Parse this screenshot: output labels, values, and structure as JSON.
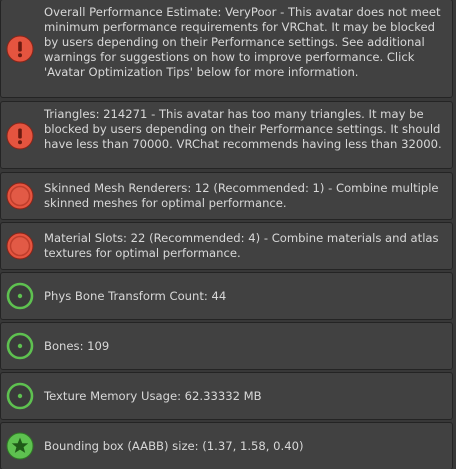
{
  "colors": {
    "error_red": "#e5543f",
    "ok_green": "#5ec150",
    "row_bg": "#414141",
    "row_border": "#242424",
    "text": "#d8d8d8"
  },
  "messages": [
    {
      "icon": "error-exclamation-icon",
      "severity": "error",
      "text": "Overall Performance Estimate: VeryPoor - This avatar does not meet minimum performance requirements for VRChat. It may be blocked by users depending on their Performance settings. See additional warnings for suggestions on how to improve performance. Click 'Avatar Optimization Tips' below for more information."
    },
    {
      "icon": "error-exclamation-icon",
      "severity": "error",
      "text": "Triangles: 214271 - This avatar has too many triangles. It may be blocked by users depending on their Performance settings. It should have less than 70000. VRChat recommends having less than 32000."
    },
    {
      "icon": "error-dot-icon",
      "severity": "warning",
      "text": "Skinned Mesh Renderers: 12 (Recommended: 1) - Combine multiple skinned meshes for optimal performance."
    },
    {
      "icon": "error-dot-icon",
      "severity": "warning",
      "text": "Material Slots: 22 (Recommended: 4) - Combine materials and atlas textures for optimal performance."
    },
    {
      "icon": "ok-ring-icon",
      "severity": "ok",
      "text": "Phys Bone Transform Count: 44"
    },
    {
      "icon": "ok-ring-icon",
      "severity": "ok",
      "text": "Bones: 109"
    },
    {
      "icon": "ok-ring-icon",
      "severity": "ok",
      "text": "Texture Memory Usage: 62.33332 MB"
    },
    {
      "icon": "star-icon",
      "severity": "excellent",
      "text": "Bounding box (AABB) size: (1.37, 1.58, 0.40)"
    }
  ]
}
